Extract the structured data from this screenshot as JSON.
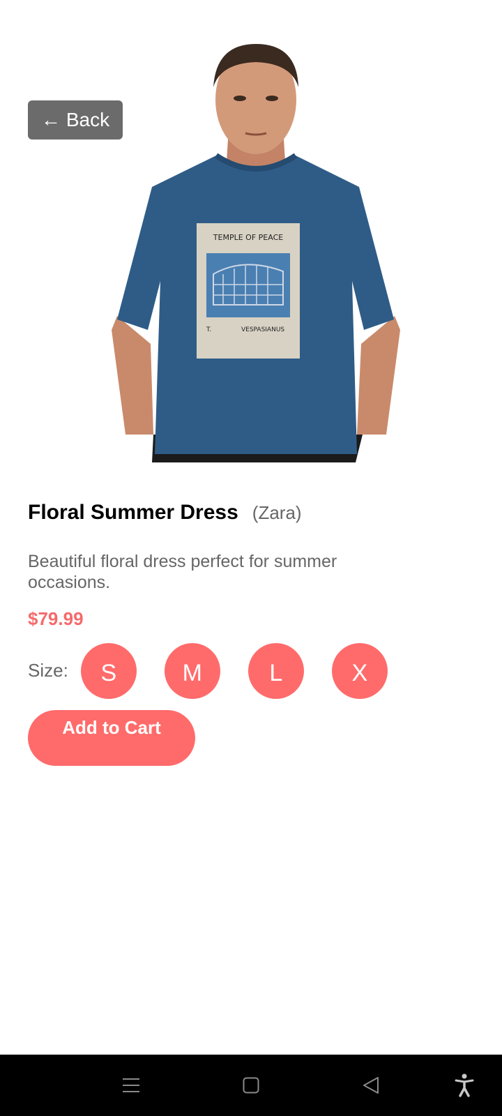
{
  "header": {
    "back_label": "Back",
    "back_icon": "arrow-left-icon"
  },
  "product": {
    "image_alt": "Model wearing blue oversized t-shirt with Temple of Peace print",
    "print_title": "TEMPLE OF PEACE",
    "print_left": "T.",
    "print_right": "VESPASIANUS",
    "title": "Floral Summer Dress",
    "brand": "(Zara)",
    "description": "Beautiful floral dress perfect for summer occasions.",
    "price": "$79.99"
  },
  "sizes": {
    "label": "Size:",
    "options": [
      "S",
      "M",
      "L",
      "X"
    ]
  },
  "actions": {
    "add_to_cart_label": "Add to Cart"
  },
  "navbar": {
    "icons": [
      "menu-icon",
      "home-square-icon",
      "back-triangle-icon",
      "accessibility-icon"
    ]
  },
  "colors": {
    "accent": "#ff6b6b",
    "price": "#f56b6b",
    "back_button": "#6b6b6b",
    "text_muted": "#666666",
    "shirt": "#2f5c87"
  }
}
